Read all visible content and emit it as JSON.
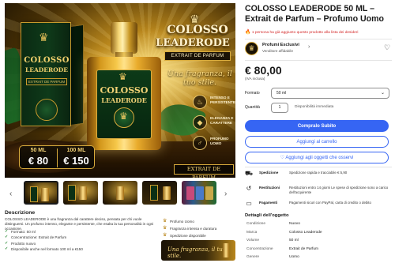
{
  "hero": {
    "box_brand_line1": "COLOSSO",
    "box_brand_line2": "LEADERODE",
    "box_subtitle": "EXTRAIT DE PARFUM",
    "bottle_brand_line1": "COLOSSO",
    "bottle_brand_line2": "LEADERODE",
    "headline_line1": "COLOSSO",
    "headline_line2": "LEADERODE",
    "headline_sub": "EXTRAIT DE PARFUM",
    "slogan": "Una fragranza, il tuo stile.",
    "features": [
      {
        "icon": "flame-icon",
        "text": "INTENSO E PERSISTENTE"
      },
      {
        "icon": "diamond-icon",
        "text": "ELEGANZA E CARATTERE"
      },
      {
        "icon": "man-icon",
        "text": "PROFUMO UOMO"
      }
    ],
    "sizes": [
      {
        "ml": "50 ML",
        "price": "€ 80"
      },
      {
        "ml": "100 ML",
        "price": "€ 150"
      }
    ],
    "extrait_label": "EXTRAIT DE PARFUM"
  },
  "gallery": {
    "prev_icon": "‹",
    "next_icon": "›",
    "thumbnail_count": 5
  },
  "description": {
    "title": "Descrizione",
    "body": "COLOSSO LEADERODE è una fragranza dal carattere deciso, pensata per chi vuole distinguersi. Un profumo intenso, elegante e persistente, che esalta la tua personalità in ogni occasione.",
    "bullets": [
      "Formato: 50 ml",
      "Concentrazione: Extrait de Parfum",
      "Prodotto nuovo",
      "Disponibile anche nel formato 100 ml a €150"
    ],
    "highlights": [
      "Profumo Uomo",
      "Fragranza intensa e duratura",
      "Spedizione disponibile"
    ],
    "promo_text": "Una fragranza, il tuo stile."
  },
  "listing": {
    "title": "COLOSSO LEADERODE 50 ML – Extrait de Parfum – Profumo Uomo",
    "watch_notice": "1 persona ha già aggiunto questo prodotto alla lista dei desideri",
    "seller_name": "Profumi Esclusivi",
    "seller_sub": "Venditore affidabile",
    "price": "€ 80,00",
    "vat": "(IVA inclusa)",
    "format_label": "Formato",
    "format_value": "50 ml",
    "qty_label": "Quantità",
    "qty_value": "1",
    "availability": "Disponibilità immediata",
    "buy_label": "Compralo Subito",
    "cart_label": "Aggiungi al carrello",
    "watch_label": "Aggiungi agli oggetti che osservi",
    "accent_color": "#3665f3"
  },
  "shipping_info": [
    {
      "icon": "truck-icon",
      "key": "Spedizione",
      "value": "Spedizione rapida e tracciabile € 5,90"
    },
    {
      "icon": "return-icon",
      "key": "Restituzioni",
      "value": "Restituzioni entro 14 giorni Le spese di spedizione sono a carico dell'acquirente"
    },
    {
      "icon": "card-icon",
      "key": "Pagamenti",
      "value": "Pagamenti sicuri con PayPal, carta di credito o debito"
    }
  ],
  "details": {
    "title": "Dettagli dell'oggetto",
    "rows": [
      {
        "k": "Condizione",
        "v": "Nuovo"
      },
      {
        "k": "Marca",
        "v": "Colosso Leaderode"
      },
      {
        "k": "Volume",
        "v": "50 ml"
      },
      {
        "k": "Concentrazione",
        "v": "Extrait de Parfum"
      },
      {
        "k": "Genere",
        "v": "Uomo"
      }
    ]
  }
}
